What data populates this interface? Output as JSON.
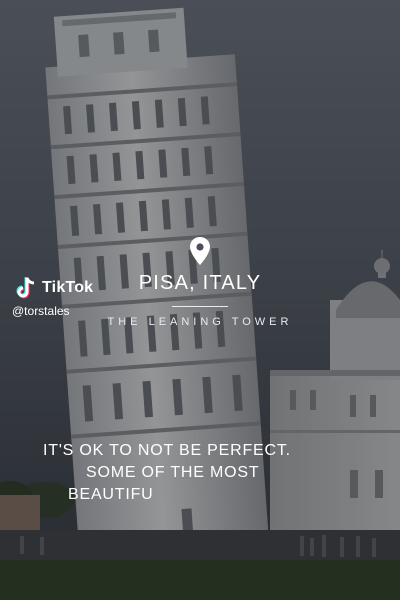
{
  "watermark": {
    "brand": "TikTok",
    "handle": "@torstales",
    "logo_icon": "tiktok-logo-icon"
  },
  "location": {
    "pin_icon": "location-pin-icon",
    "place": "PISA, ITALY",
    "subtitle": "THE LEANING TOWER"
  },
  "caption": {
    "line1": "IT'S OK TO NOT BE PERFECT.",
    "line2": "SOME OF THE MOST",
    "line3": "BEAUTIFU"
  },
  "colors": {
    "text": "#ffffff",
    "tiktok_cyan": "#25f4ee",
    "tiktok_red": "#fe2c55"
  }
}
